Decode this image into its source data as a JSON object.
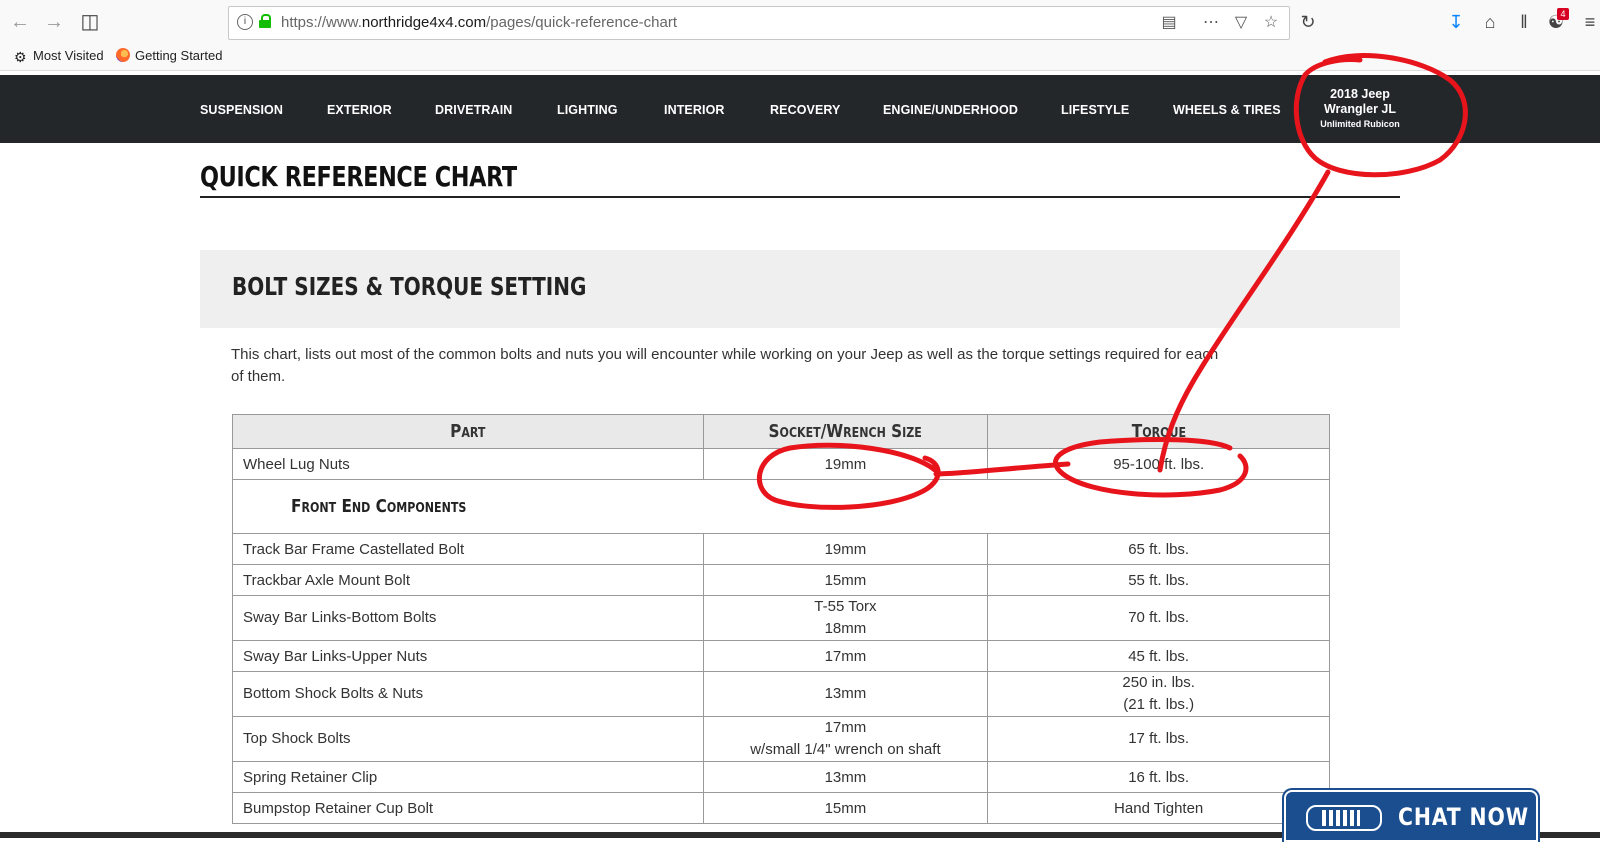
{
  "browser": {
    "url_prefix": "https://www.",
    "url_domain": "northridge4x4.com",
    "url_path": "/pages/quick-reference-chart",
    "notification_count": "4",
    "bookmarks": [
      "Most Visited",
      "Getting Started"
    ]
  },
  "sitenav": {
    "items": [
      "SUSPENSION",
      "EXTERIOR",
      "DRIVETRAIN",
      "LIGHTING",
      "INTERIOR",
      "RECOVERY",
      "ENGINE/UNDERHOOD",
      "LIFESTYLE",
      "WHEELS & TIRES"
    ],
    "vehicle_line1": "2018 Jeep",
    "vehicle_line2": "Wrangler JL",
    "vehicle_line3": "Unlimited Rubicon"
  },
  "page": {
    "title": "QUICK REFERENCE CHART",
    "section_title": "BOLT SIZES & TORQUE SETTING",
    "intro": "This chart, lists out most of the common bolts and nuts you will encounter while working on your Jeep as well as the torque settings required for each of them."
  },
  "table": {
    "headers": [
      "Part",
      "Socket/Wrench Size",
      "Torque"
    ],
    "first_row": {
      "part": "Wheel Lug Nuts",
      "size": "19mm",
      "torque": "95-100 ft. lbs."
    },
    "section": "Front End Components",
    "rows": [
      {
        "part": "Track Bar Frame Castellated Bolt",
        "size": [
          "19mm"
        ],
        "torque": [
          "65 ft. lbs."
        ]
      },
      {
        "part": "Trackbar Axle Mount Bolt",
        "size": [
          "15mm"
        ],
        "torque": [
          "55 ft. lbs."
        ]
      },
      {
        "part": "Sway Bar Links-Bottom Bolts",
        "size": [
          "T-55 Torx",
          "18mm"
        ],
        "torque": [
          "70 ft. lbs."
        ]
      },
      {
        "part": "Sway Bar Links-Upper Nuts",
        "size": [
          "17mm"
        ],
        "torque": [
          "45 ft. lbs."
        ]
      },
      {
        "part": "Bottom Shock Bolts & Nuts",
        "size": [
          "13mm"
        ],
        "torque": [
          "250 in. lbs.",
          "(21 ft. lbs.)"
        ]
      },
      {
        "part": "Top Shock Bolts",
        "size": [
          "17mm",
          "w/small 1/4\" wrench on shaft"
        ],
        "torque": [
          "17 ft. lbs."
        ]
      },
      {
        "part": "Spring Retainer Clip",
        "size": [
          "13mm"
        ],
        "torque": [
          "16 ft. lbs."
        ]
      },
      {
        "part": "Bumpstop Retainer Cup Bolt",
        "size": [
          "15mm"
        ],
        "torque": [
          "Hand Tighten"
        ]
      }
    ]
  },
  "chat": {
    "label": "CHAT NOW"
  },
  "colors": {
    "nav_bg": "#24272a",
    "annotation": "#e8141c",
    "chat_bg": "#1a4e8f"
  }
}
